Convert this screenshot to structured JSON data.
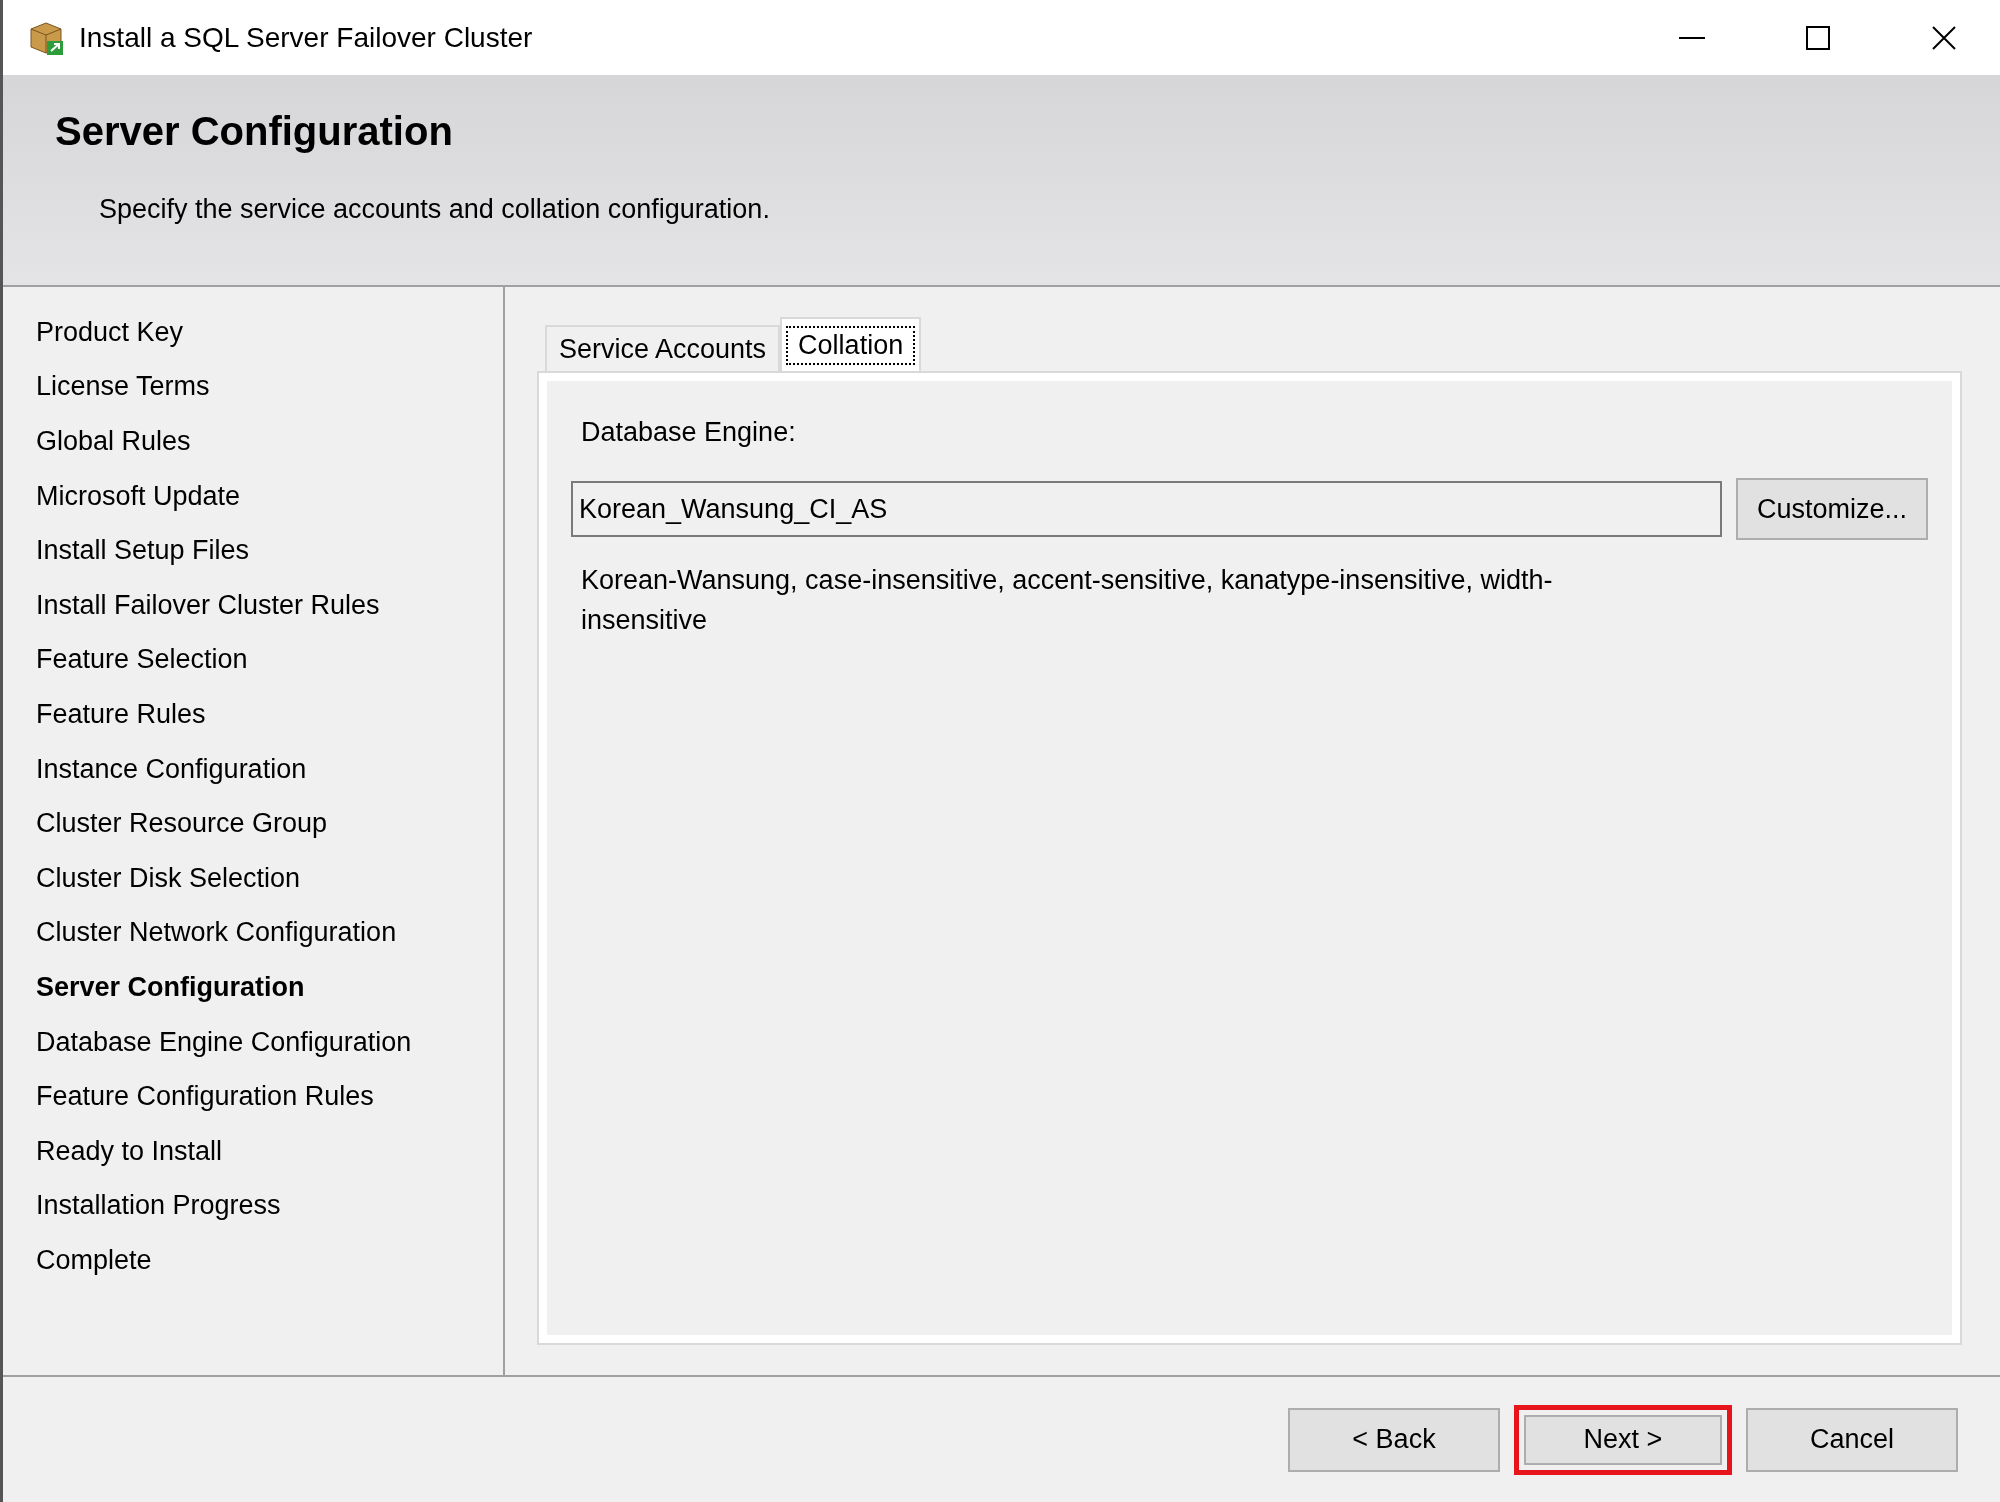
{
  "window": {
    "title": "Install a SQL Server Failover Cluster"
  },
  "header": {
    "title": "Server Configuration",
    "subtitle": "Specify the service accounts and collation configuration."
  },
  "sidebar": {
    "items": [
      {
        "label": "Product Key",
        "current": false
      },
      {
        "label": "License Terms",
        "current": false
      },
      {
        "label": "Global Rules",
        "current": false
      },
      {
        "label": "Microsoft Update",
        "current": false
      },
      {
        "label": "Install Setup Files",
        "current": false
      },
      {
        "label": "Install Failover Cluster Rules",
        "current": false
      },
      {
        "label": "Feature Selection",
        "current": false
      },
      {
        "label": "Feature Rules",
        "current": false
      },
      {
        "label": "Instance Configuration",
        "current": false
      },
      {
        "label": "Cluster Resource Group",
        "current": false
      },
      {
        "label": "Cluster Disk Selection",
        "current": false
      },
      {
        "label": "Cluster Network Configuration",
        "current": false
      },
      {
        "label": "Server Configuration",
        "current": true
      },
      {
        "label": "Database Engine Configuration",
        "current": false
      },
      {
        "label": "Feature Configuration Rules",
        "current": false
      },
      {
        "label": "Ready to Install",
        "current": false
      },
      {
        "label": "Installation Progress",
        "current": false
      },
      {
        "label": "Complete",
        "current": false
      }
    ]
  },
  "tabs": [
    {
      "label": "Service Accounts",
      "selected": false
    },
    {
      "label": "Collation",
      "selected": true
    }
  ],
  "collation": {
    "label": "Database Engine:",
    "value": "Korean_Wansung_CI_AS",
    "button": "Customize...",
    "description": "Korean-Wansung, case-insensitive, accent-sensitive, kanatype-insensitive, width-insensitive"
  },
  "buttons": [
    {
      "label": "< Back",
      "highlighted": false
    },
    {
      "label": "Next >",
      "highlighted": true
    },
    {
      "label": "Cancel",
      "highlighted": false
    }
  ]
}
